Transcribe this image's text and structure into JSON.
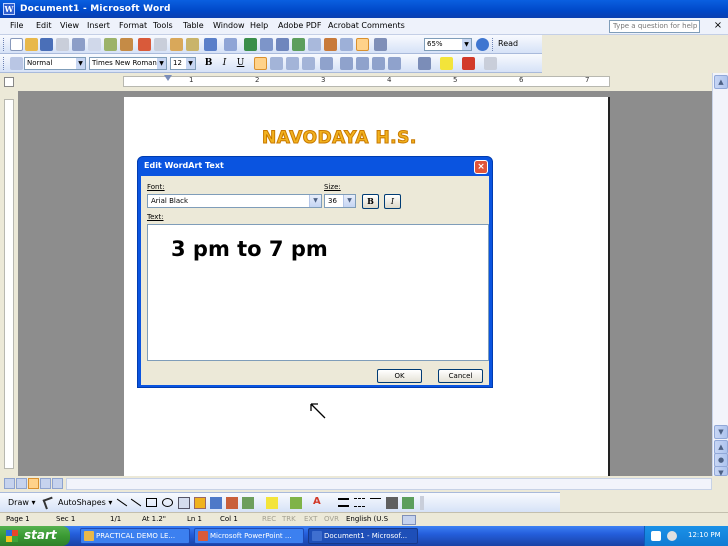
{
  "window": {
    "title": "Document1 - Microsoft Word"
  },
  "menu": {
    "items": [
      "File",
      "Edit",
      "View",
      "Insert",
      "Format",
      "Tools",
      "Table",
      "Window",
      "Help",
      "Adobe PDF",
      "Acrobat Comments"
    ],
    "help_placeholder": "Type a question for help"
  },
  "standard_toolbar": {
    "zoom": "65%",
    "read_label": "Read"
  },
  "formatting_toolbar": {
    "style": "Normal",
    "font": "Times New Roman",
    "size": "12",
    "bold": "B",
    "italic": "I",
    "underline": "U"
  },
  "ruler": {
    "numbers": [
      "1",
      "2",
      "3",
      "4",
      "5",
      "6",
      "7"
    ]
  },
  "document": {
    "wordart_text": "NAVODAYA H.S."
  },
  "dialog": {
    "title": "Edit WordArt Text",
    "font_label": "Font:",
    "font_value": "Arial Black",
    "size_label": "Size:",
    "size_value": "36",
    "bold_label": "B",
    "italic_label": "I",
    "text_label": "Text:",
    "text_value": "3 pm to 7 pm",
    "ok_label": "OK",
    "cancel_label": "Cancel"
  },
  "drawing_toolbar": {
    "draw_label": "Draw",
    "autoshapes_label": "AutoShapes"
  },
  "status": {
    "page": "Page 1",
    "section": "Sec 1",
    "pages": "1/1",
    "at": "At 1.2\"",
    "line": "Ln 1",
    "col": "Col 1",
    "rec": "REC",
    "trk": "TRK",
    "ext": "EXT",
    "ovr": "OVR",
    "language": "English (U.S"
  },
  "taskbar": {
    "start": "start",
    "tasks": [
      "PRACTICAL DEMO LE...",
      "Microsoft PowerPoint ...",
      "Document1 - Microsof..."
    ],
    "clock": "12:10 PM"
  },
  "colors": {
    "wordart_fill": "#F2B21E",
    "titlebar": "#0A5FE0",
    "taskbar": "#245EDB",
    "start": "#3A9A33"
  }
}
